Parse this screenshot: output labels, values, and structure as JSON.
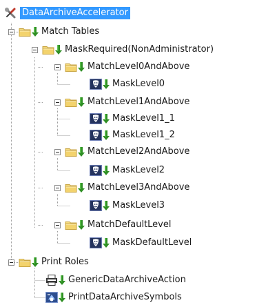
{
  "colors": {
    "selection": "#3399ff",
    "arrow": "#2f8f24",
    "folder": "#f3d36d",
    "mask_icon_bg": "#24335e"
  },
  "tree": {
    "root": {
      "label": "DataArchiveAccelerator",
      "icon": "wrench-screwdriver-icon",
      "selected": true
    },
    "match_tables": {
      "label": "Match Tables",
      "icon": "folder-icon"
    },
    "mask_required": {
      "label": "MaskRequired(NonAdministrator)",
      "icon": "folder-icon"
    },
    "level0": {
      "label": "MatchLevel0AndAbove",
      "icon": "folder-icon",
      "mask": "MaskLevel0"
    },
    "level1": {
      "label": "MatchLevel1AndAbove",
      "icon": "folder-icon",
      "masks": [
        "MaskLevel1_1",
        "MaskLevel1_2"
      ]
    },
    "level2": {
      "label": "MatchLevel2AndAbove",
      "icon": "folder-icon",
      "mask": "MaskLevel2"
    },
    "level3": {
      "label": "MatchLevel3AndAbove",
      "icon": "folder-icon",
      "mask": "MaskLevel3"
    },
    "default_level": {
      "label": "MatchDefaultLevel",
      "icon": "folder-icon",
      "mask": "MaskDefaultLevel"
    },
    "print_roles": {
      "label": "Print Roles",
      "icon": "folder-icon"
    },
    "generic_action": {
      "label": "GenericDataArchiveAction",
      "icon": "printer-role-icon"
    },
    "print_symbols": {
      "label": "PrintDataArchiveSymbols",
      "icon": "print-symbols-icon"
    }
  }
}
